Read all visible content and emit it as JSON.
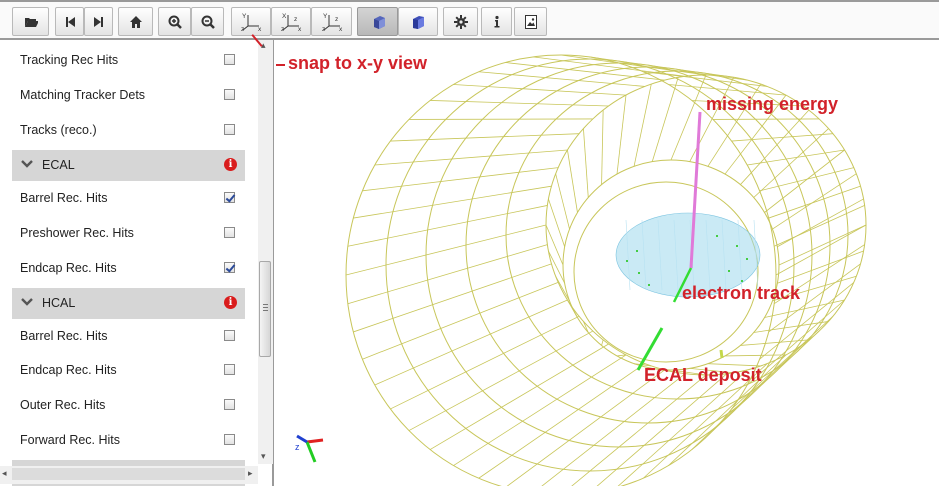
{
  "toolbar": {
    "buttons": [
      {
        "icon": "folder-open-icon"
      },
      {
        "icon": "step-backward-icon"
      },
      {
        "icon": "step-forward-icon"
      },
      {
        "icon": "home-icon"
      },
      {
        "icon": "zoom-in-icon"
      },
      {
        "icon": "zoom-out-icon"
      },
      {
        "icon": "xy-view-icon"
      },
      {
        "icon": "zx-view-icon"
      },
      {
        "icon": "yz-view-icon"
      },
      {
        "icon": "perspective-cube-icon",
        "active": true
      },
      {
        "icon": "orthographic-cube-icon"
      },
      {
        "icon": "gear-icon"
      },
      {
        "icon": "info-icon"
      },
      {
        "icon": "save-image-icon"
      }
    ],
    "axis_labels": {
      "xy": [
        "Y",
        "z",
        "x"
      ],
      "zx": [
        "X",
        "z",
        "x",
        "z"
      ],
      "yz": [
        "Y",
        "z",
        "x",
        "z"
      ]
    }
  },
  "sidebar": {
    "items": [
      {
        "type": "row",
        "label": "Tracking Rec Hits",
        "checked": false
      },
      {
        "type": "row",
        "label": "Matching Tracker Dets",
        "checked": false
      },
      {
        "type": "row",
        "label": "Tracks (reco.)",
        "checked": false
      },
      {
        "type": "group",
        "label": "ECAL"
      },
      {
        "type": "row",
        "label": "Barrel Rec. Hits",
        "checked": true
      },
      {
        "type": "row",
        "label": "Preshower Rec. Hits",
        "checked": false
      },
      {
        "type": "row",
        "label": "Endcap Rec. Hits",
        "checked": true
      },
      {
        "type": "group",
        "label": "HCAL"
      },
      {
        "type": "row",
        "label": "Barrel Rec. Hits",
        "checked": false
      },
      {
        "type": "row",
        "label": "Endcap Rec. Hits",
        "checked": false
      },
      {
        "type": "row",
        "label": "Outer Rec. Hits",
        "checked": false
      },
      {
        "type": "row",
        "label": "Forward Rec. Hits",
        "checked": false
      }
    ],
    "info_glyph": "i",
    "scroll": {
      "up": "▴",
      "down": "▾",
      "left": "◂",
      "right": "▸"
    }
  },
  "annotations": {
    "snap": "snap to x-y view",
    "missing_energy": "missing energy",
    "electron_track": "electron track",
    "ecal_deposit": "ECAL deposit"
  },
  "axes_gizmo": {
    "y_label": "y",
    "z_label": "z"
  },
  "colors": {
    "annotation": "#d2222a",
    "wireframe": "#c8c65a",
    "missing_energy": "#e07ad8",
    "track": "#33dd33",
    "ecal_cloud": "#9fd8ec",
    "info_badge": "#d91c1c"
  }
}
